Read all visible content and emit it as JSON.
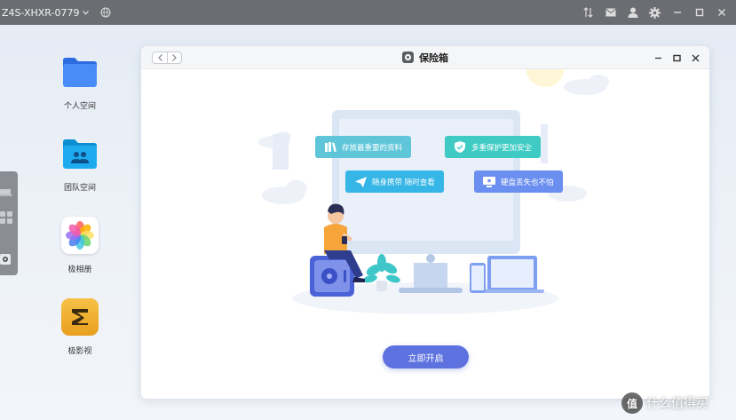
{
  "topbar": {
    "device_name": "Z4S-XHXR-0779",
    "icons": [
      "chevron-down-icon",
      "globe-icon",
      "transfer-icon",
      "mail-icon",
      "user-icon",
      "gear-icon",
      "minimize-icon",
      "maximize-icon",
      "close-icon"
    ]
  },
  "desktop": {
    "items": [
      {
        "label": "个人空间",
        "icon": "folder-icon",
        "color": "#3d7ef4"
      },
      {
        "label": "团队空间",
        "icon": "team-folder-icon",
        "color": "#1aa6ea"
      },
      {
        "label": "极相册",
        "icon": "photos-icon",
        "color": "#ffffff"
      },
      {
        "label": "极影视",
        "icon": "video-icon",
        "color": "#f0b232"
      }
    ]
  },
  "window": {
    "title": "保险箱",
    "features": [
      {
        "label": "存放最重要的资料",
        "icon": "files-icon",
        "color": "#5fc6d9"
      },
      {
        "label": "多重保护更加安全",
        "icon": "shield-icon",
        "color": "#3fcbc4"
      },
      {
        "label": "随身携带 随时查看",
        "icon": "send-icon",
        "color": "#36b6e6"
      },
      {
        "label": "硬盘丢失也不怕",
        "icon": "monitor-icon",
        "color": "#6b8ff0"
      }
    ],
    "start_button": "立即开启"
  },
  "watermark": {
    "badge": "值",
    "text": "什么值得买"
  }
}
